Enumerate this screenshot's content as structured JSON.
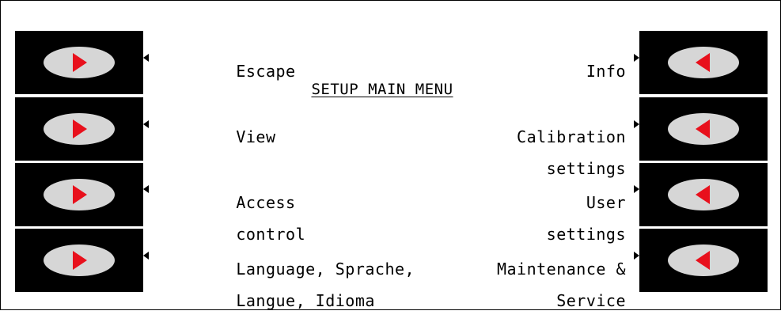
{
  "screen": {
    "title": "SETUP MAIN MENU",
    "left_options": [
      {
        "line1": "Escape",
        "line2": ""
      },
      {
        "line1": "View",
        "line2": ""
      },
      {
        "line1": "Access",
        "line2": "control"
      },
      {
        "line1": "Language, Sprache,",
        "line2": "Langue, Idioma"
      }
    ],
    "right_options": [
      {
        "line1": "Info",
        "line2": ""
      },
      {
        "line1": "Calibration",
        "line2": "settings"
      },
      {
        "line1": "User",
        "line2": "settings"
      },
      {
        "line1": "Maintenance &",
        "line2": "Service"
      }
    ]
  },
  "colors": {
    "arrow": "#e8101c",
    "key_face": "#d6d6d6",
    "bezel": "#000000"
  },
  "icons": {
    "left_keys": "arrow-right-icon",
    "right_keys": "arrow-left-icon"
  }
}
